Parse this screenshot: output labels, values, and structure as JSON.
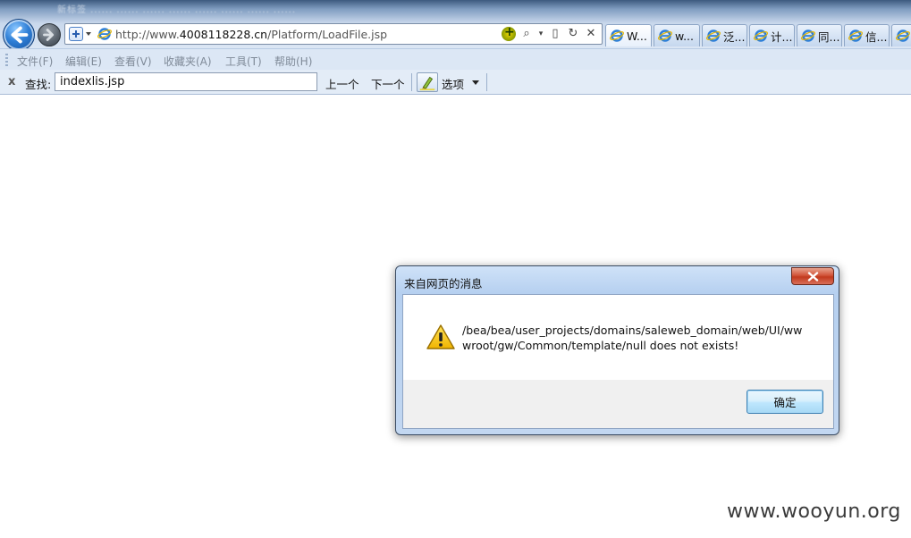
{
  "browser": {
    "title_blur": "新标签  ......  ......  ......  ......  ......  ......  ......  ......",
    "address": {
      "prefix": "http://www.",
      "host": "4008118228.cn",
      "path": "/Platform/LoadFile.jsp"
    },
    "tabs": [
      {
        "label": "W...",
        "active": true
      },
      {
        "label": "w...",
        "active": false
      },
      {
        "label": "泛...",
        "active": false
      },
      {
        "label": "计...",
        "active": false
      },
      {
        "label": "同...",
        "active": false
      },
      {
        "label": "信...",
        "active": false
      },
      {
        "label": "",
        "active": false
      }
    ]
  },
  "menubar": {
    "items": [
      "文件(F)",
      "编辑(E)",
      "查看(V)",
      "收藏夹(A)",
      "工具(T)",
      "帮助(H)"
    ]
  },
  "findbar": {
    "close_glyph": "x",
    "label": "查找:",
    "query": "indexlis.jsp",
    "prev_label": "上一个",
    "next_label": "下一个",
    "options_label": "选项"
  },
  "dialog": {
    "title": "来自网页的消息",
    "message": "/bea/bea/user_projects/domains/saleweb_domain/web/UI/wwwroot/gw/Common/template/null does not exists!",
    "ok_label": "确定"
  },
  "watermark": "www.wooyun.org",
  "colors": {
    "dialog_close": "#c23a1e",
    "ok_button_border": "#3c7fb1",
    "warning_yellow": "#f5c400"
  }
}
